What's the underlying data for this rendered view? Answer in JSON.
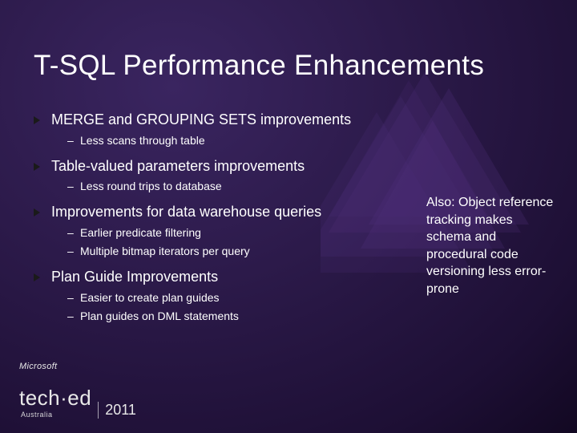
{
  "title": "T-SQL Performance Enhancements",
  "bullets": [
    {
      "headline": "MERGE and GROUPING SETS improvements",
      "subs": [
        "Less scans through table"
      ]
    },
    {
      "headline": "Table-valued parameters improvements",
      "subs": [
        "Less round trips to database"
      ]
    },
    {
      "headline": "Improvements for data warehouse queries",
      "subs": [
        "Earlier predicate filtering",
        "Multiple bitmap iterators per query"
      ]
    },
    {
      "headline": "Plan Guide Improvements",
      "subs": [
        "Easier to create plan guides",
        "Plan guides on DML statements"
      ]
    }
  ],
  "sidebar_note": "Also: Object reference tracking makes schema and procedural code versioning less error-prone",
  "footer": {
    "brand_small": "Microsoft",
    "brand_main": "tech·ed",
    "region": "Australia",
    "year": "2011"
  }
}
